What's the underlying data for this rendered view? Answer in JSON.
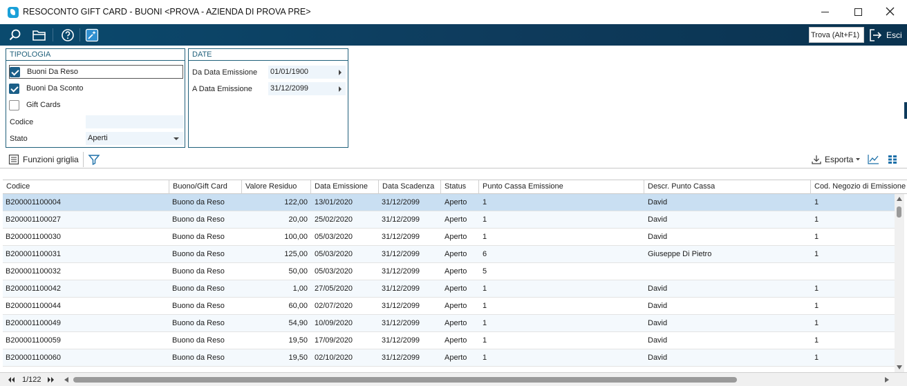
{
  "window": {
    "title": "RESOCONTO GIFT CARD - BUONI <PROVA - AZIENDA DI PROVA PRE>"
  },
  "toolbar": {
    "icons": [
      "search-icon",
      "folder-open-icon",
      "help-icon",
      "magic-icon"
    ],
    "search_placeholder": "Trova (Alt+F1)",
    "exit_label": "Esci"
  },
  "tipologia": {
    "title": "TIPOLOGIA",
    "checkboxes": [
      {
        "label": "Buoni Da Reso",
        "checked": true
      },
      {
        "label": "Buoni Da Sconto",
        "checked": true
      },
      {
        "label": "Gift Cards",
        "checked": false
      }
    ],
    "codice_label": "Codice",
    "codice_value": "",
    "stato_label": "Stato",
    "stato_value": "Aperti"
  },
  "date": {
    "title": "DATE",
    "from_label": "Da Data Emissione",
    "from_value": "01/01/1900",
    "to_label": "A Data Emissione",
    "to_value": "31/12/2099"
  },
  "grid_toolbar": {
    "funzioni_label": "Funzioni griglia",
    "esporta_label": "Esporta"
  },
  "grid": {
    "columns": [
      "Codice",
      "Buono/Gift Card",
      "Valore Residuo",
      "Data Emissione",
      "Data Scadenza",
      "Status",
      "Punto Cassa Emissione",
      "Descr. Punto Cassa",
      "Cod. Negozio di Emissione"
    ],
    "rows": [
      [
        "B200001100004",
        "Buono da Reso",
        "122,00",
        "13/01/2020",
        "31/12/2099",
        "Aperto",
        "1",
        "David",
        "1"
      ],
      [
        "B200001100027",
        "Buono da Reso",
        "20,00",
        "25/02/2020",
        "31/12/2099",
        "Aperto",
        "1",
        "David",
        "1"
      ],
      [
        "B200001100030",
        "Buono da Reso",
        "100,00",
        "05/03/2020",
        "31/12/2099",
        "Aperto",
        "1",
        "David",
        "1"
      ],
      [
        "B200001100031",
        "Buono da Reso",
        "125,00",
        "05/03/2020",
        "31/12/2099",
        "Aperto",
        "6",
        "Giuseppe Di Pietro",
        "1"
      ],
      [
        "B200001100032",
        "Buono da Reso",
        "50,00",
        "05/03/2020",
        "31/12/2099",
        "Aperto",
        "5",
        "",
        ""
      ],
      [
        "B200001100042",
        "Buono da Reso",
        "1,00",
        "27/05/2020",
        "31/12/2099",
        "Aperto",
        "1",
        "David",
        "1"
      ],
      [
        "B200001100044",
        "Buono da Reso",
        "60,00",
        "02/07/2020",
        "31/12/2099",
        "Aperto",
        "1",
        "David",
        "1"
      ],
      [
        "B200001100049",
        "Buono da Reso",
        "54,90",
        "10/09/2020",
        "31/12/2099",
        "Aperto",
        "1",
        "David",
        "1"
      ],
      [
        "B200001100059",
        "Buono da Reso",
        "19,50",
        "17/09/2020",
        "31/12/2099",
        "Aperto",
        "1",
        "David",
        "1"
      ],
      [
        "B200001100060",
        "Buono da Reso",
        "19,50",
        "02/10/2020",
        "31/12/2099",
        "Aperto",
        "1",
        "David",
        "1"
      ]
    ]
  },
  "status": {
    "pager": "1/122"
  },
  "colors": {
    "toolbar_bg": "#0e3b5c",
    "panel_border": "#1f5f7a",
    "selected_row": "#c9dff2",
    "checkbox_on": "#1b5f88"
  }
}
